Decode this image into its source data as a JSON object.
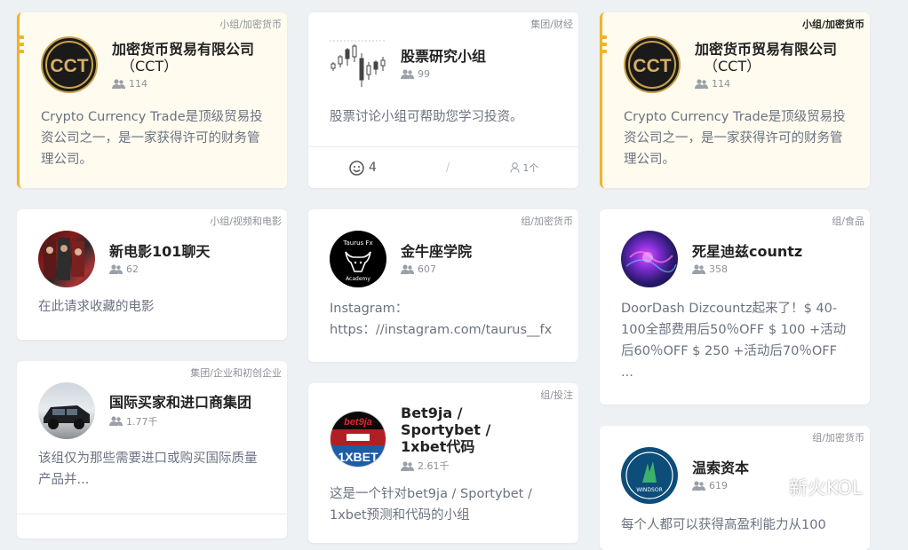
{
  "cards": {
    "c1": {
      "tag": "小组/加密货币",
      "title_line1": "加密货币贸易有限公司",
      "title_line2": "（CCT）",
      "members": "114",
      "desc": "Crypto Currency Trade是顶级贸易投资公司之一，是一家获得许可的财务管理公司。",
      "logo": "CCT"
    },
    "c2": {
      "tag": "小组/视频和电影",
      "title": "新电影101聊天",
      "members": "62",
      "desc": "在此请求收藏的电影"
    },
    "c3": {
      "tag": "集团/企业和初创企业",
      "title": "国际买家和进口商集团",
      "members": "1.77千",
      "desc": "该组仅为那些需要进口或购买国际质量产品并..."
    },
    "c4": {
      "tag": "集团/财经",
      "title": "股票研究小组",
      "members": "99",
      "desc": "股票讨论小组可帮助您学习投资。",
      "reactions": "4",
      "slash": "/",
      "people": "1个"
    },
    "c5": {
      "tag": "组/加密货币",
      "title": "金牛座学院",
      "members": "607",
      "desc_line1": "Instagram：",
      "desc_line2": "https：//instagram.com/taurus__fx",
      "logo_top": "Taurus Fx",
      "logo_bottom": "Academy"
    },
    "c6": {
      "tag": "组/投注",
      "title": "Bet9ja / Sportybet / 1xbet代码",
      "members": "2.61千",
      "desc": "这是一个针对bet9ja / Sportybet / 1xbet预测和代码的小组",
      "logo_top": "bet9ja",
      "logo_bottom": "1XBET"
    },
    "c7": {
      "tag": "小组/加密货币",
      "title_line1": "加密货币贸易有限公司",
      "title_line2": "（CCT）",
      "members": "114",
      "desc": "Crypto Currency Trade是顶级贸易投资公司之一，是一家获得许可的财务管理公司。",
      "logo": "CCT"
    },
    "c8": {
      "tag": "组/食品",
      "title": "死星迪兹countz",
      "members": "358",
      "desc": "DoorDash Dizcountz起来了！$ 40-100全部费用后50％OFF $ 100 +活动后60％OFF $ 250 +活动后70％OFF ..."
    },
    "c9": {
      "tag": "组/加密货币",
      "title": "温索资本",
      "members": "619",
      "desc": "每个人都可以获得高盈利能力从100",
      "logo": "WINDSOR"
    }
  },
  "watermark": "新火KOL",
  "colors": {
    "accent": "#f0b429",
    "featured_bg": "#fffbef",
    "page_bg": "#eef1f4"
  }
}
